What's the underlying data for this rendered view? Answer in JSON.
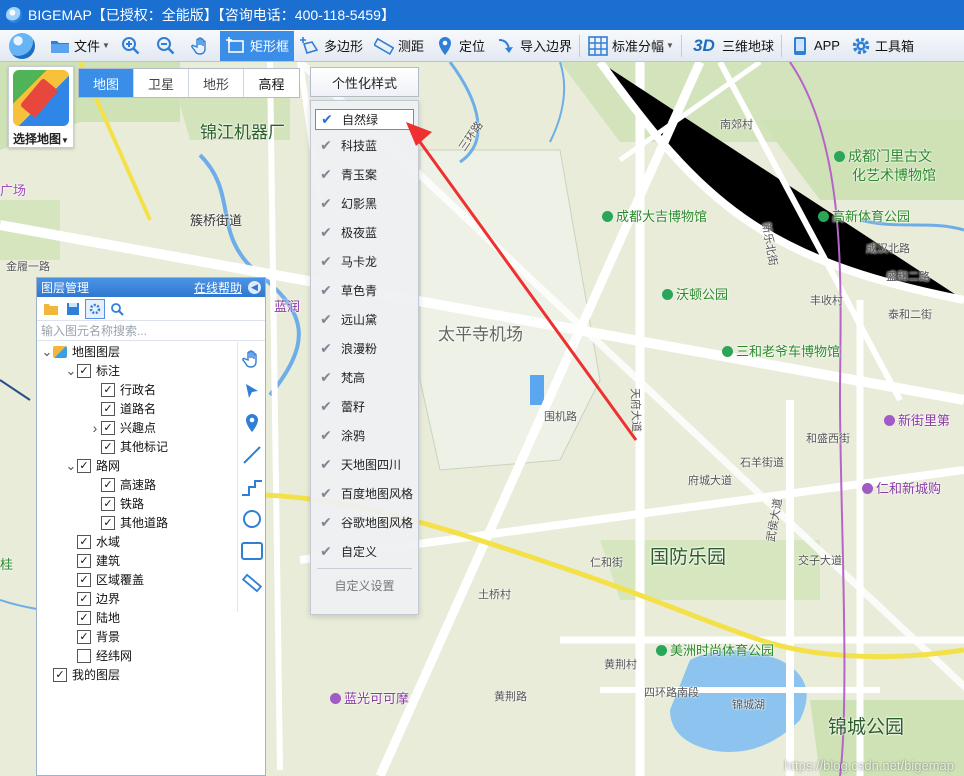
{
  "title_bar": {
    "text": "BIGEMAP【已授权：全能版】【咨询电话：400-118-5459】"
  },
  "toolbar": {
    "items": [
      {
        "label": "文件",
        "icon": "folder-icon",
        "dropdown": true
      },
      {
        "label": "",
        "icon": "zoom-in-icon"
      },
      {
        "label": "",
        "icon": "zoom-out-icon"
      },
      {
        "label": "",
        "icon": "pan-hand-icon"
      },
      {
        "label": "矩形框",
        "icon": "rectangle-select-icon",
        "active": true
      },
      {
        "label": "多边形",
        "icon": "polygon-icon"
      },
      {
        "label": "测距",
        "icon": "ruler-icon"
      },
      {
        "label": "定位",
        "icon": "location-pin-icon"
      },
      {
        "label": "导入边界",
        "icon": "import-arrow-icon"
      },
      {
        "label": "标准分幅",
        "icon": "grid-icon",
        "dropdown": true
      },
      {
        "label": "三维地球",
        "icon": "3d-icon"
      },
      {
        "label": "APP",
        "icon": "phone-icon"
      },
      {
        "label": "工具箱",
        "icon": "gear-icon"
      }
    ],
    "three_d_text": "3D"
  },
  "map_selector": {
    "choose_label": "选择地图",
    "tabs": [
      "地图",
      "卫星",
      "地形",
      "高程"
    ],
    "active_tab": "地图"
  },
  "style_menu": {
    "button_label": "个性化样式",
    "items": [
      "自然绿",
      "科技蓝",
      "青玉案",
      "幻影黑",
      "极夜蓝",
      "马卡龙",
      "草色青",
      "远山黛",
      "浪漫粉",
      "梵高",
      "蕾籽",
      "涂鸦",
      "天地图四川",
      "百度地图风格",
      "谷歌地图风格",
      "自定义"
    ],
    "selected": "自然绿",
    "custom_settings": "自定义设置"
  },
  "layer_panel": {
    "title": "图层管理",
    "help": "在线帮助",
    "search_placeholder": "输入图元名称搜索...",
    "tree": [
      {
        "label": "地图图层",
        "level": 0,
        "arrow": "down",
        "icon": "folder"
      },
      {
        "label": "标注",
        "level": 1,
        "arrow": "down",
        "checked": true
      },
      {
        "label": "行政名",
        "level": 2,
        "checked": true
      },
      {
        "label": "道路名",
        "level": 2,
        "checked": true
      },
      {
        "label": "兴趣点",
        "level": 2,
        "arrow": "right",
        "checked": true
      },
      {
        "label": "其他标记",
        "level": 2,
        "checked": true
      },
      {
        "label": "路网",
        "level": 1,
        "arrow": "down",
        "checked": true
      },
      {
        "label": "高速路",
        "level": 2,
        "checked": true
      },
      {
        "label": "铁路",
        "level": 2,
        "checked": true
      },
      {
        "label": "其他道路",
        "level": 2,
        "checked": true
      },
      {
        "label": "水域",
        "level": 1,
        "checked": true
      },
      {
        "label": "建筑",
        "level": 1,
        "checked": true
      },
      {
        "label": "区域覆盖",
        "level": 1,
        "checked": true
      },
      {
        "label": "边界",
        "level": 1,
        "checked": true
      },
      {
        "label": "陆地",
        "level": 1,
        "checked": true
      },
      {
        "label": "背景",
        "level": 1,
        "checked": true
      },
      {
        "label": "经纬网",
        "level": 1,
        "checked": false
      },
      {
        "label": "我的图层",
        "level": 0,
        "checked": true
      }
    ]
  },
  "map_labels": {
    "jinjiang": "锦江机器厂",
    "xiaqiao": "簇桥街道",
    "taipingsi": "太平寺机场",
    "guofang": "国防乐园",
    "jincheng": "锦城公园",
    "nanjiao": "南郊村",
    "chengdu_museum": "成都大吉博物馆",
    "gaoxin": "高新体育公园",
    "wodun": "沃顿公园",
    "sanhe": "三和老爷车博物馆",
    "chengdu_menli": "成都门里古文",
    "chengdu_menli2": "化艺术博物馆",
    "xinjie": "新街里第",
    "renhe": "仁和新城购",
    "meizhou": "美洲时尚体育公园",
    "languang": "蓝光可可摩",
    "jinchenghu": "锦城湖",
    "shimu": "石羊街道",
    "wuhouqu": "武侯大道",
    "chengdu_road": "成汉北路",
    "shengren": "盛和二路",
    "taihe": "泰和二街",
    "fengqing": "丰收村",
    "xinle": "新乐北街",
    "weijilu": "围机路",
    "fucheng": "府城大道",
    "hesheng": "和盛西街",
    "jiaozhi": "交子大道",
    "tianfu": "天府大道",
    "renhejie": "仁和街",
    "huanghe": "黄荆路",
    "huanghecun": "黄荆村",
    "sihuan": "四环路南段",
    "tuqiao": "土桥村",
    "sanhuan": "三环路",
    "guangchang": "广场",
    "jinhu": "金履一路",
    "lanrun": "蓝润",
    "zhu": "桂",
    "watermark": "https://blog.csdn.net/bigemap"
  }
}
